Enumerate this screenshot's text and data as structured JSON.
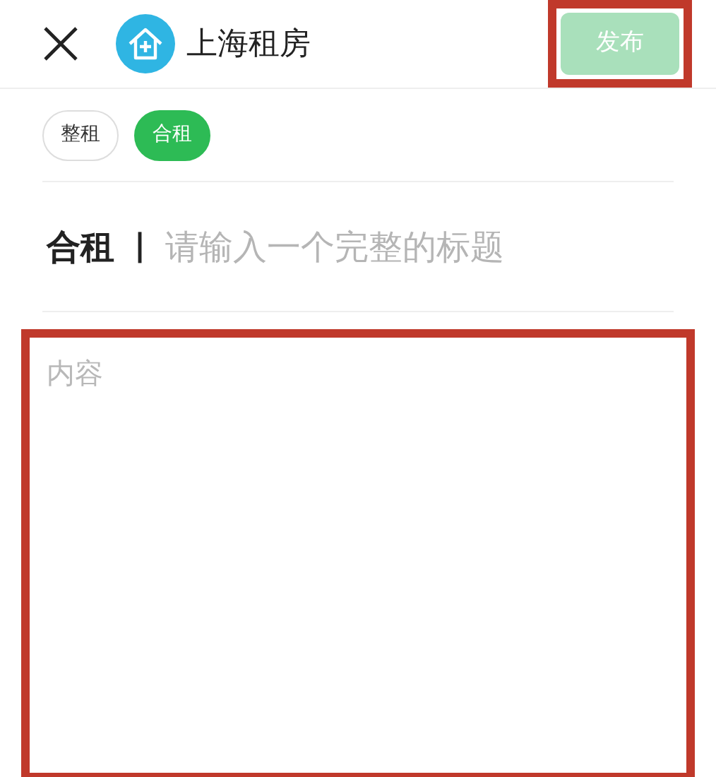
{
  "header": {
    "title": "上海租房",
    "publish_button": {
      "label": "发布",
      "disabled": true,
      "highlighted": true
    }
  },
  "tags": [
    {
      "label": "整租",
      "selected": false
    },
    {
      "label": "合租",
      "selected": true
    }
  ],
  "title_field": {
    "prefix": "合租",
    "separator": "|",
    "placeholder": "请输入一个完整的标题"
  },
  "content_field": {
    "placeholder": "内容",
    "highlighted": true
  }
}
